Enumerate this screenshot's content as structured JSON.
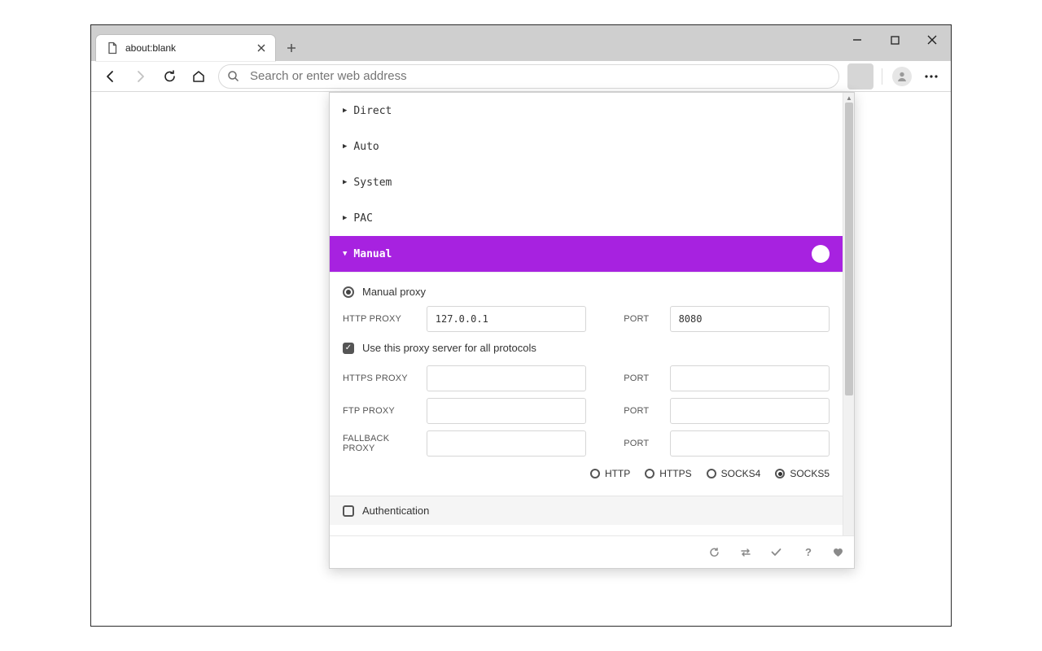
{
  "window": {
    "tab_title": "about:blank",
    "omnibox_placeholder": "Search or enter web address"
  },
  "colors": {
    "red": "#e8492e",
    "orange": "#e2a21e",
    "green": "#3fae2a",
    "blue": "#1f8fe0",
    "purple": "#a722e0"
  },
  "popup": {
    "modes": {
      "direct": {
        "label": "Direct",
        "color": "#e8492e"
      },
      "auto": {
        "label": "Auto",
        "color": "#e2a21e"
      },
      "system": {
        "label": "System",
        "color": "#3fae2a"
      },
      "pac": {
        "label": "PAC",
        "color": "#1f8fe0"
      },
      "manual": {
        "label": "Manual",
        "color": "#a722e0"
      }
    },
    "manual": {
      "scheme_label": "Manual proxy",
      "labels": {
        "http": "HTTP PROXY",
        "https": "HTTPS PROXY",
        "ftp": "FTP PROXY",
        "fallback": "FALLBACK PROXY",
        "port": "PORT"
      },
      "http_host": "127.0.0.1",
      "http_port": "8080",
      "use_for_all_label": "Use this proxy server for all protocols",
      "use_for_all_checked": true,
      "https_host": "",
      "https_port": "",
      "ftp_host": "",
      "ftp_port": "",
      "fallback_host": "",
      "fallback_port": "",
      "protocols": {
        "http": {
          "label": "HTTP",
          "selected": false
        },
        "https": {
          "label": "HTTPS",
          "selected": false
        },
        "socks4": {
          "label": "SOCKS4",
          "selected": false
        },
        "socks5": {
          "label": "SOCKS5",
          "selected": true
        }
      }
    },
    "auth": {
      "label": "Authentication",
      "checked": false
    }
  }
}
